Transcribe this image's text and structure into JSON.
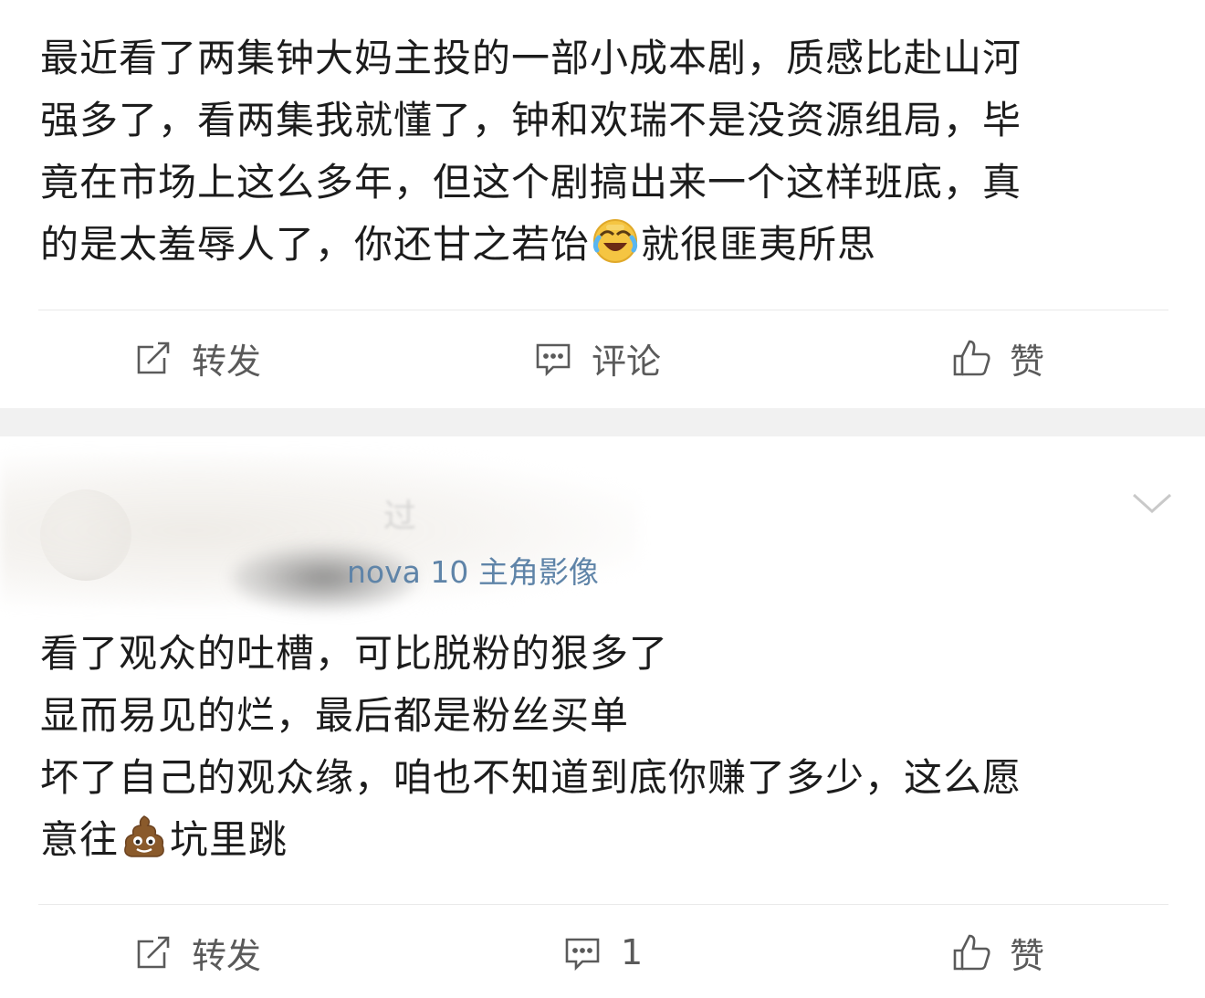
{
  "post1": {
    "text_lines": [
      "最近看了两集钟大妈主投的一部小成本剧，质感比赴山河",
      "强多了，看两集我就懂了，钟和欢瑞不是没资源组局，毕",
      "竟在市场上这么多年，但这个剧搞出来一个这样班底，真",
      "的是太羞辱人了，你还甘之若饴"
    ],
    "text_tail": "就很匪夷所思",
    "emoji": "laughing-crying-face",
    "actions": {
      "repost": "转发",
      "comment": "评论",
      "like": "赞"
    }
  },
  "post2": {
    "username": "过",
    "source": "nova 10 主角影像",
    "text_lines": [
      "看了观众的吐槽，可比脱粉的狠多了",
      "显而易见的烂，最后都是粉丝买单",
      "坏了自己的观众缘，咱也不知道到底你赚了多少，这么愿",
      "意往"
    ],
    "text_tail": "坑里跳",
    "emoji": "pile-of-poo",
    "actions": {
      "repost": "转发",
      "comment_count": "1",
      "like": "赞"
    }
  },
  "colors": {
    "text": "#1c1c1c",
    "action": "#5a5a5a",
    "source_link": "#5f84a8",
    "gap": "#f1f1f1"
  }
}
